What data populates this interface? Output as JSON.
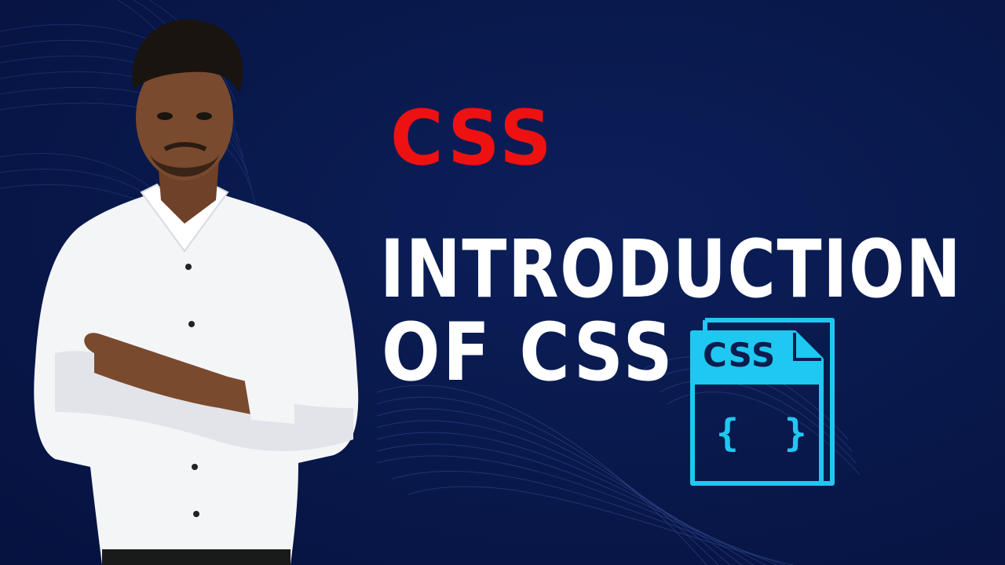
{
  "thumbnail": {
    "heading_small": "CSS",
    "heading_line1": "INTRODUCTION",
    "heading_line2": "OF CSS"
  },
  "icon": {
    "name": "css-file-icon",
    "label": "CSS",
    "braces": "{  }"
  },
  "colors": {
    "background": "#08184a",
    "accent_red": "#ee1111",
    "text_white": "#ffffff",
    "icon_cyan": "#1ec8f0"
  }
}
